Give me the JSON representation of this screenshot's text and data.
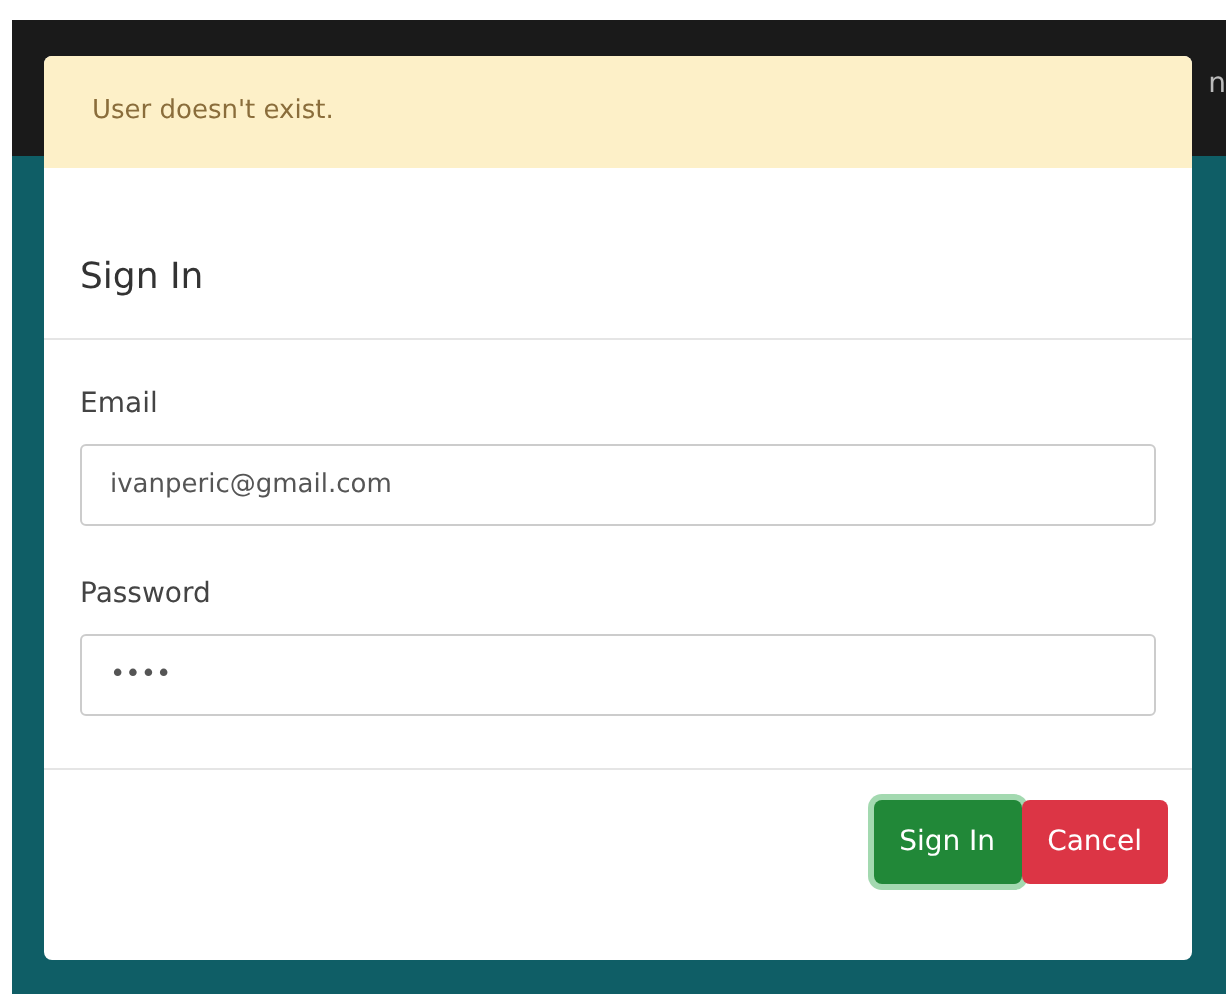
{
  "navbar": {
    "text": "n"
  },
  "alert": {
    "text": "User doesn't exist."
  },
  "modal": {
    "title": "Sign In",
    "fields": [
      {
        "label": "Email",
        "value": "ivanperic@gmail.com"
      },
      {
        "label": "Password",
        "value": "••••"
      }
    ],
    "buttons": [
      {
        "label": "Sign In",
        "kind": "primary",
        "focused": true
      },
      {
        "label": "Cancel",
        "kind": "danger",
        "focused": false
      }
    ]
  }
}
